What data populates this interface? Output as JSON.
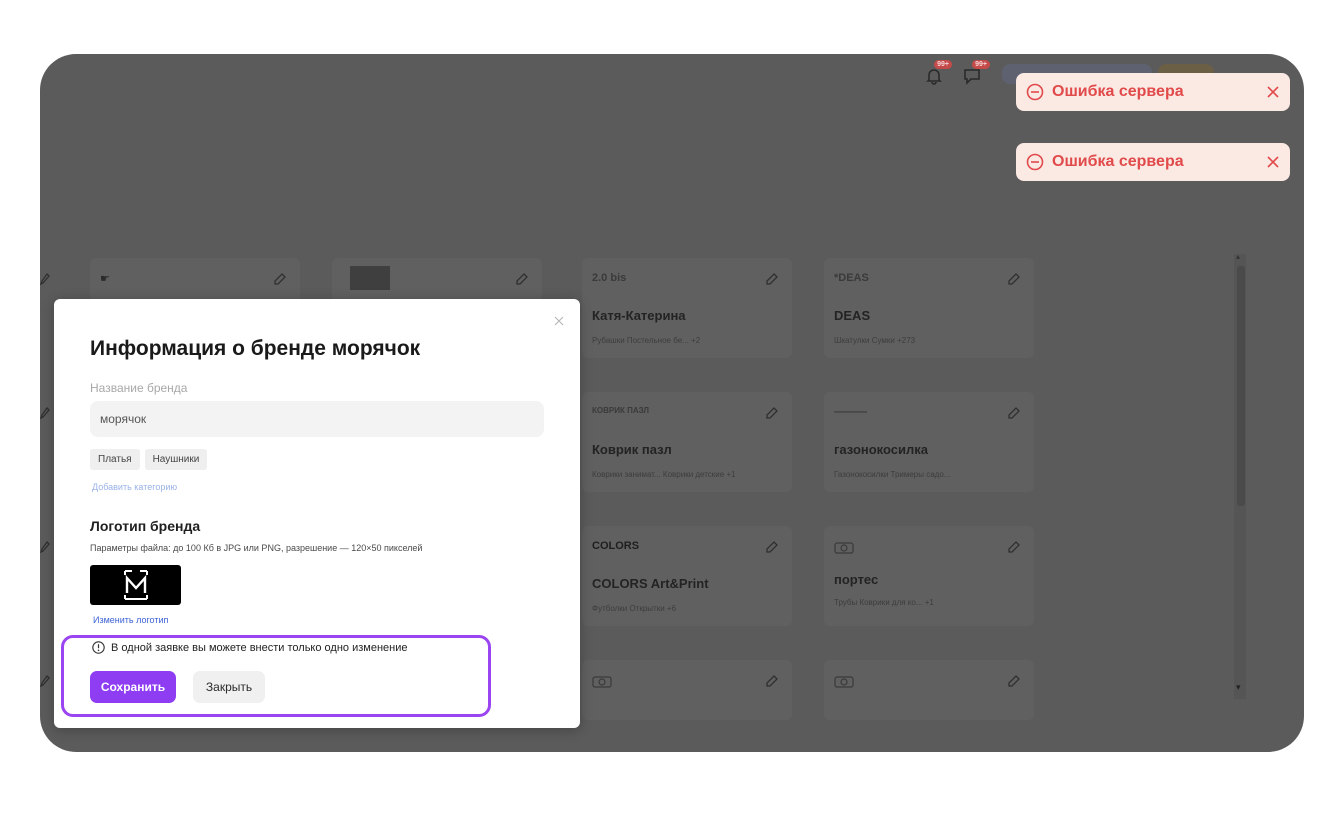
{
  "colors": {
    "overlay": "#5b5b5b",
    "accent": "#8e3df2",
    "highlight_border": "#9b44f1",
    "toast_bg": "#fbe9e4",
    "toast_text": "#e14a4a",
    "link": "#3d62d6"
  },
  "header": {
    "icons": [
      "bell-icon",
      "chat-icon"
    ]
  },
  "toasts": [
    {
      "text": "Ошибка сервера",
      "icon": "minus-circle-icon"
    },
    {
      "text": "Ошибка сервера",
      "icon": "minus-circle-icon"
    }
  ],
  "background_cards": [
    {
      "logo": "2.0 bis",
      "title": "Катя-Катерина",
      "tags": "Рубашки  Постельное бе...  +2"
    },
    {
      "logo": "*DEAS",
      "title": "DEAS",
      "tags": "Шкатулки  Сумки  +273"
    },
    {
      "logo": "КОВРИК ПАЗЛ",
      "title": "Коврик пазл",
      "tags": "Коврики занимат...  Коврики детские  +1"
    },
    {
      "logo": "———",
      "title": "газонокосилка",
      "tags": "Газонокосилки  Тримеры садо..."
    },
    {
      "logo": "COLORS",
      "title": "COLORS Art&Print",
      "tags": "Футболки  Открытки  +6"
    },
    {
      "logo": "camera",
      "title": "портес",
      "tags": "Трубы  Коврики для ко...  +1"
    }
  ],
  "modal": {
    "title": "Информация о бренде морячок",
    "brand_name_label": "Название бренда",
    "brand_name_value": "морячок",
    "categories": [
      "Платья",
      "Наушники"
    ],
    "add_category": "Добавить категорию",
    "logo_heading": "Логотип бренда",
    "logo_params": "Параметры файла: до 100 Кб в JPG или PNG, разрешение — 120×50 пикселей",
    "change_logo": "Изменить логотип",
    "info_text": "В одной заявке вы можете внести только одно изменение",
    "save_label": "Сохранить",
    "cancel_label": "Закрыть"
  }
}
